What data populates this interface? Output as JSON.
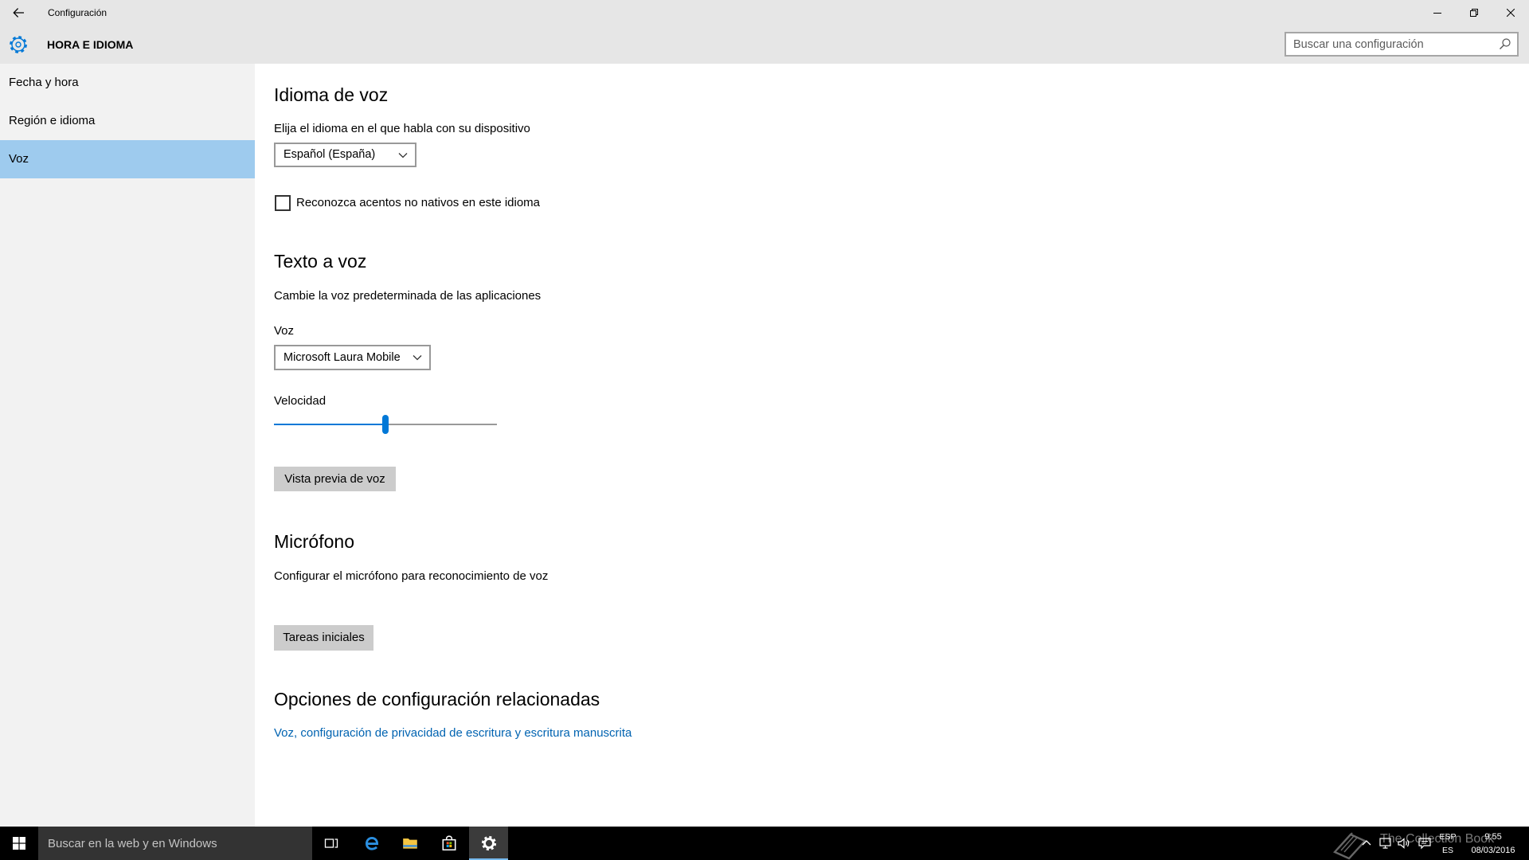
{
  "window": {
    "title": "Configuración",
    "back_icon": "back-arrow-icon",
    "controls": {
      "minimize_icon": "minimize-icon",
      "restore_icon": "restore-icon",
      "close_icon": "close-icon"
    }
  },
  "header": {
    "icon": "gear-icon",
    "title": "HORA E IDIOMA",
    "search": {
      "placeholder": "Buscar una configuración",
      "value": "",
      "icon": "search-icon"
    }
  },
  "sidebar": {
    "items": [
      {
        "label": "Fecha y hora",
        "selected": false
      },
      {
        "label": "Región e idioma",
        "selected": false
      },
      {
        "label": "Voz",
        "selected": true
      }
    ]
  },
  "main": {
    "speech_language": {
      "heading": "Idioma de voz",
      "prompt": "Elija el idioma en el que habla con su dispositivo",
      "language_selected": "Español (España)",
      "accent_checkbox": {
        "label": "Reconozca acentos no nativos en este idioma",
        "checked": false
      }
    },
    "text_to_speech": {
      "heading": "Texto a voz",
      "description": "Cambie la voz predeterminada de las aplicaciones",
      "voice_label": "Voz",
      "voice_selected": "Microsoft Laura Mobile",
      "speed_label": "Velocidad",
      "speed_level": 0.5,
      "preview_button": "Vista previa de voz"
    },
    "microphone": {
      "heading": "Micrófono",
      "description": "Configurar el micrófono para reconocimiento de voz",
      "button": "Tareas iniciales"
    },
    "related_settings": {
      "heading": "Opciones de configuración relacionadas",
      "link": "Voz, configuración de privacidad de escritura y escritura manuscrita"
    }
  },
  "taskbar": {
    "start_icon": "windows-logo-icon",
    "search_placeholder": "Buscar en la web y en Windows",
    "pinned_apps": [
      {
        "icon": "task-view-icon",
        "active": false
      },
      {
        "icon": "edge-icon",
        "active": false
      },
      {
        "icon": "file-explorer-icon",
        "active": false
      },
      {
        "icon": "store-icon",
        "active": false
      },
      {
        "icon": "settings-gear-icon",
        "active": true
      }
    ],
    "tray": {
      "icons": [
        "chevron-up-icon",
        "network-icon",
        "volume-icon",
        "action-center-icon"
      ],
      "input_language": "ESP",
      "keyboard_layout": "ES",
      "time": "9:55",
      "date": "08/03/2016"
    }
  },
  "watermark": {
    "text": "The Collection Book",
    "icon": "book-logo-icon"
  },
  "colors": {
    "accent": "#0078d7",
    "link": "#0063b1",
    "nav_selected": "#9ecbee",
    "header_bg": "#e6e6e6",
    "sidebar_bg": "#f2f2f2",
    "taskbar_bg": "#000000",
    "taskbar_search_bg": "#333333",
    "button_bg": "#cccccc"
  }
}
